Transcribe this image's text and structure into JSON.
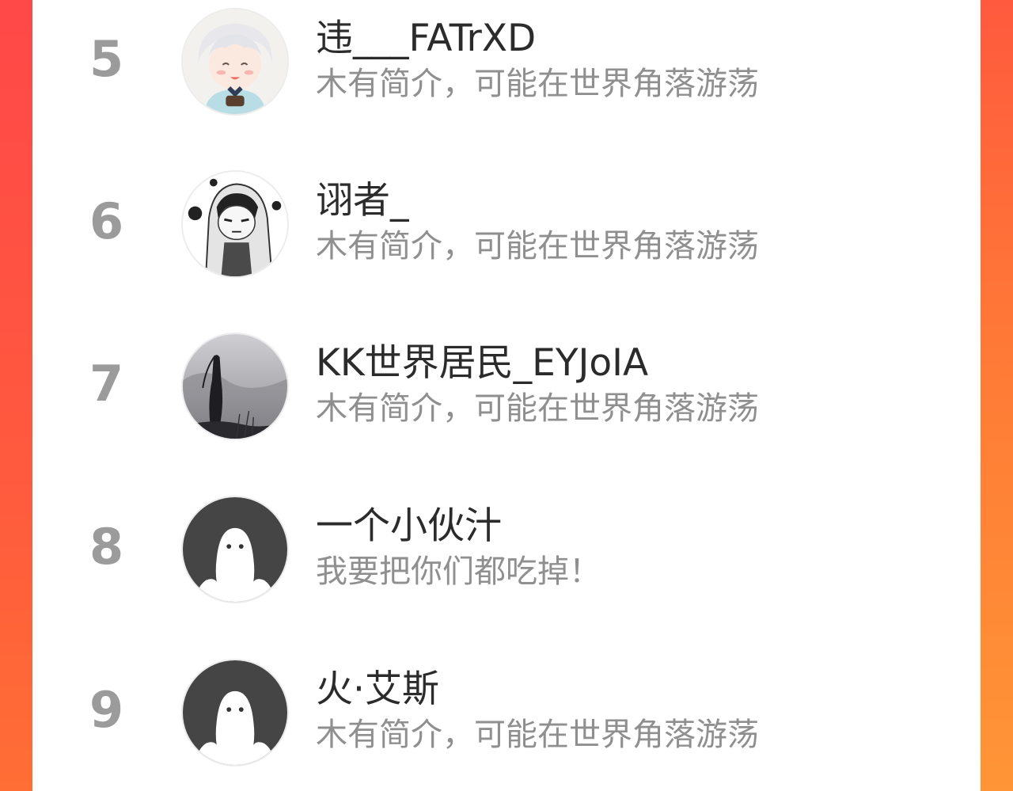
{
  "ranking": {
    "items": [
      {
        "rank": "5",
        "name": "违___FATrXD",
        "bio": "木有简介，可能在世界角落游荡",
        "avatar_icon": "anime-boy-avatar-icon"
      },
      {
        "rank": "6",
        "name": "诩者_",
        "bio": "木有简介，可能在世界角落游荡",
        "avatar_icon": "sketch-character-avatar-icon"
      },
      {
        "rank": "7",
        "name": "KK世界居民_EYJoIA",
        "bio": "木有简介，可能在世界角落游荡",
        "avatar_icon": "ink-landscape-avatar-icon"
      },
      {
        "rank": "8",
        "name": "一个小伙汁",
        "bio": "我要把你们都吃掉！",
        "avatar_icon": "default-ghost-avatar-icon"
      },
      {
        "rank": "9",
        "name": "火·艾斯",
        "bio": "木有简介，可能在世界角落游荡",
        "avatar_icon": "default-ghost-avatar-icon"
      }
    ]
  },
  "colors": {
    "background_gradient_top": "#ff4a4a",
    "background_gradient_bottom": "#ff8a36",
    "card": "#ffffff",
    "rank_text": "#9b9b9b",
    "name_text": "#2b2b2b",
    "bio_text": "#8f8f8f",
    "default_avatar": "#454545"
  }
}
